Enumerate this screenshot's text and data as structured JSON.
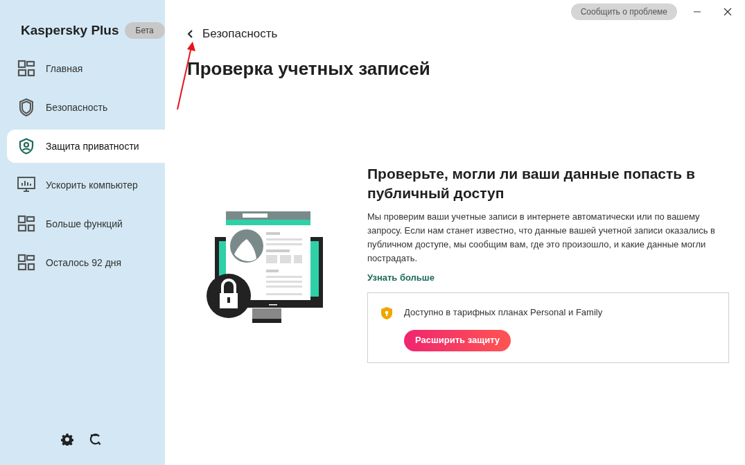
{
  "app": {
    "title": "Kaspersky Plus",
    "badge": "Бета"
  },
  "sidebar": {
    "items": [
      {
        "label": "Главная",
        "kind": "grid",
        "selected": false
      },
      {
        "label": "Безопасность",
        "kind": "shield",
        "selected": false
      },
      {
        "label": "Защита приватности",
        "kind": "user-shield",
        "selected": true
      },
      {
        "label": "Ускорить компьютер",
        "kind": "monitor",
        "selected": false
      },
      {
        "label": "Больше функций",
        "kind": "grid",
        "selected": false
      },
      {
        "label": "Осталось 92 дня",
        "kind": "grid",
        "selected": false
      }
    ]
  },
  "top_bar": {
    "report_button": "Сообщить о проблеме"
  },
  "back_link": "Безопасность",
  "page_title": "Проверка учетных записей",
  "content": {
    "heading": "Проверьте, могли ли ваши данные попасть в публичный доступ",
    "description": "Мы проверим ваши учетные записи в интернете автоматически или по вашему запросу. Если нам станет известно, что данные вашей учетной записи оказались в публичном доступе, мы сообщим вам, где это произошло, и какие данные могли пострадать.",
    "learn_more": "Узнать больше",
    "plan_notice": {
      "text": "Доступно в тарифных планах Personal и Family",
      "button": "Расширить защиту"
    }
  }
}
